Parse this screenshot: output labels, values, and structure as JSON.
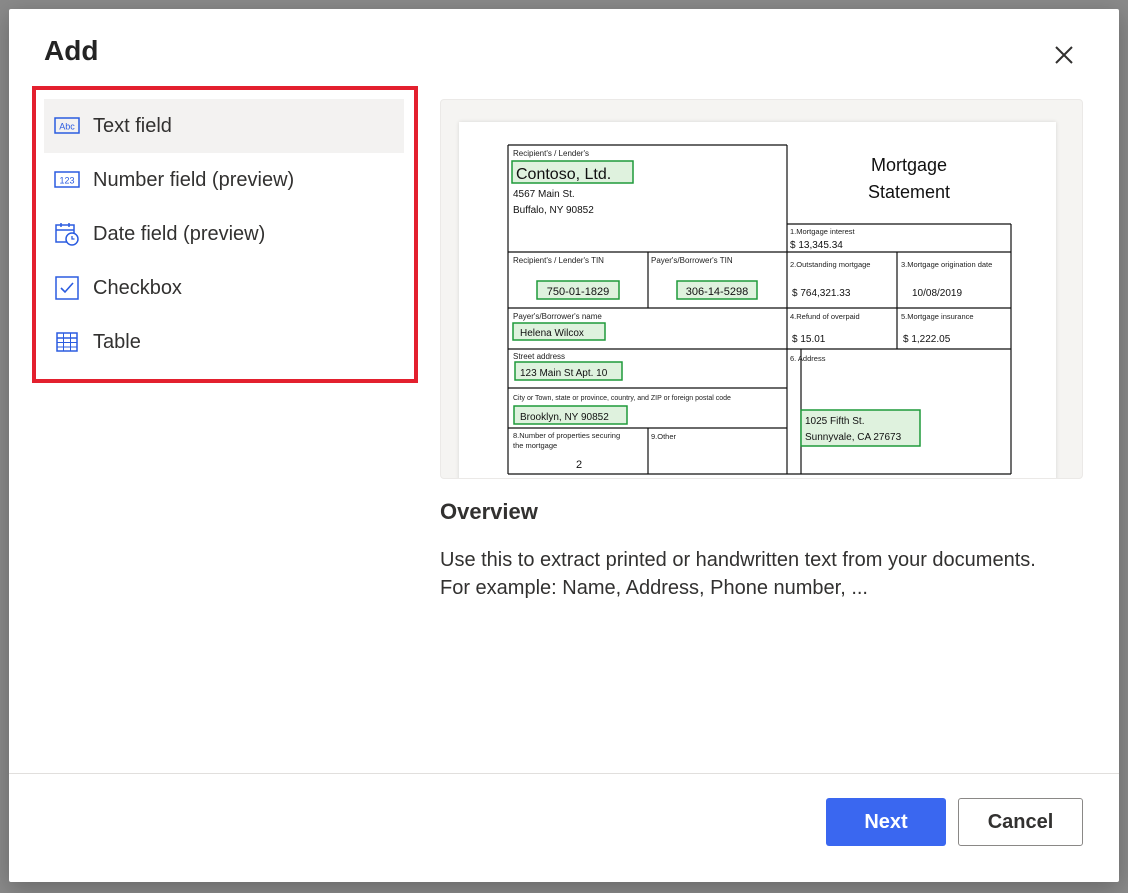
{
  "dialog": {
    "title": "Add"
  },
  "options": [
    {
      "label": "Text field",
      "icon": "text-field-icon",
      "selected": true
    },
    {
      "label": "Number field (preview)",
      "icon": "number-field-icon",
      "selected": false
    },
    {
      "label": "Date field (preview)",
      "icon": "date-field-icon",
      "selected": false
    },
    {
      "label": "Checkbox",
      "icon": "checkbox-icon",
      "selected": false
    },
    {
      "label": "Table",
      "icon": "table-icon",
      "selected": false
    }
  ],
  "preview": {
    "doc_title_line1": "Mortgage",
    "doc_title_line2": "Statement",
    "lender_caption": "Recipient's / Lender's",
    "lender_name": "Contoso, Ltd.",
    "lender_addr1": "4567 Main St.",
    "lender_addr2": "Buffalo, NY 90852",
    "interest_caption": "1.Mortgage interest",
    "interest_value": "$  13,345.34",
    "lender_tin_caption": "Recipient's / Lender's TIN",
    "lender_tin": "750-01-1829",
    "payer_tin_caption": "Payer's/Borrower's TIN",
    "payer_tin": "306-14-5298",
    "outstanding_caption": "2.Outstanding mortgage",
    "outstanding_value": "$  764,321.33",
    "origination_caption": "3.Mortgage origination date",
    "origination_value": "10/08/2019",
    "payer_name_caption": "Payer's/Borrower's name",
    "payer_name": "Helena Wilcox",
    "refund_caption": "4.Refund of overpaid",
    "refund_value": "$  15.01",
    "insurance_caption": "5.Mortgage insurance",
    "insurance_value": "$  1,222.05",
    "street_caption": "Street address",
    "street_value": "123 Main St Apt. 10",
    "address_caption": "6. Address",
    "city_caption": "City or Town, state or province, country, and ZIP or foreign postal code",
    "city_value": "Brooklyn, NY 90852",
    "address_line1": "1025 Fifth St.",
    "address_line2": "Sunnyvale, CA 27673",
    "properties_caption_1": "8.Number of properties securing",
    "properties_caption_2": "the mortgage",
    "properties_value": "2",
    "other_caption": "9.Other"
  },
  "overview": {
    "title": "Overview",
    "line1": "Use this to extract printed or handwritten text from your documents.",
    "line2": "For example: Name, Address, Phone number, ..."
  },
  "footer": {
    "next_label": "Next",
    "cancel_label": "Cancel"
  },
  "colors": {
    "accent": "#3a67f0",
    "highlight_border": "#e3202e",
    "field_box": "#1f9a3a",
    "field_fill": "#dff2de",
    "icon_blue": "#2b5ce0"
  }
}
